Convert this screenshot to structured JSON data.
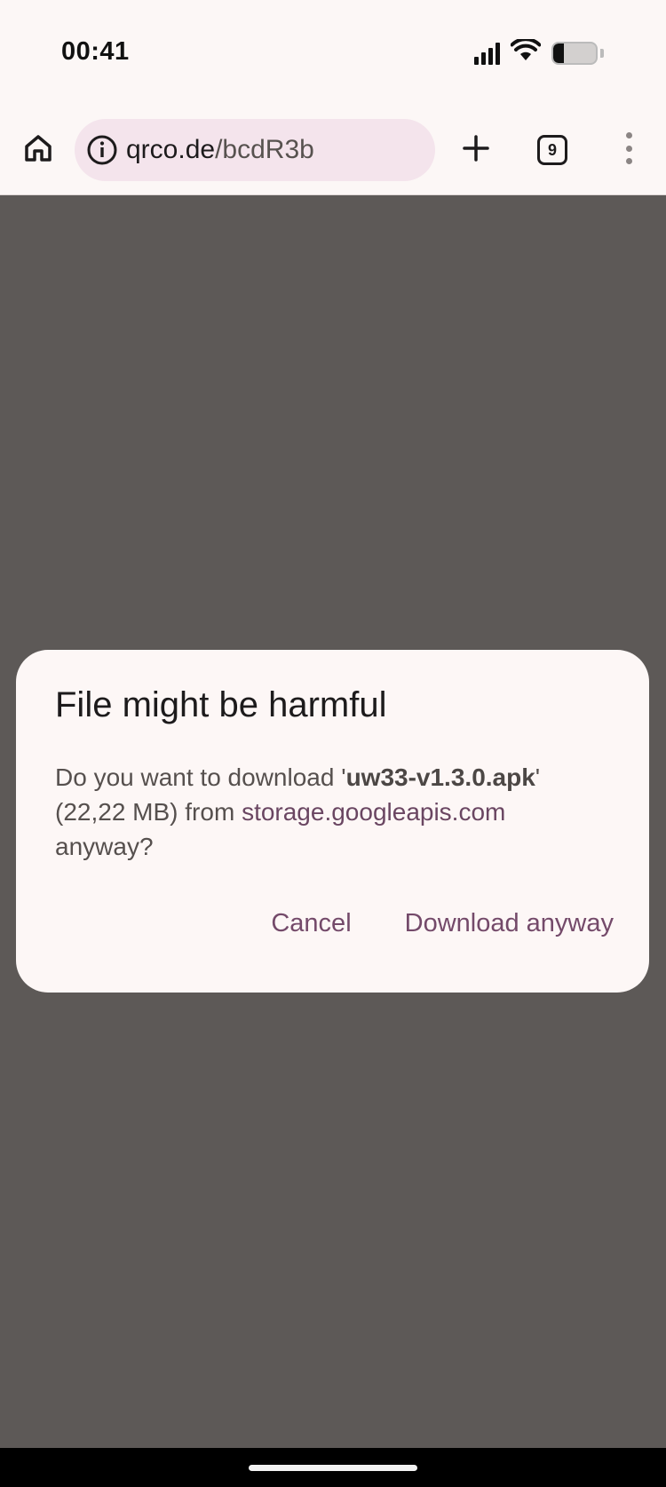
{
  "status_bar": {
    "time": "00:41",
    "battery_level": 0.25,
    "icons": [
      "signal-icon",
      "wifi-icon",
      "battery-icon"
    ]
  },
  "toolbar": {
    "url_host": "qrco.de",
    "url_path": "/bcdR3b",
    "tab_count": "9",
    "icons": [
      "home-icon",
      "info-icon",
      "plus-icon",
      "tabs-icon",
      "more-vert-icon"
    ]
  },
  "dialog": {
    "title": "File might be harmful",
    "body_prefix": "Do you want to download '",
    "filename": "uw33-v1.3.0.apk",
    "body_middle": "' (22,22 MB) from ",
    "host": "storage.googleapis.com",
    "body_suffix": " anyway?",
    "cancel_label": "Cancel",
    "confirm_label": "Download anyway"
  },
  "colors": {
    "page_dim": "#5d5957",
    "chrome_bg": "#fcf7f6",
    "url_bar_bg": "#f4e4ec",
    "dialog_bg": "#fdf7f6",
    "accent": "#744a6a"
  }
}
